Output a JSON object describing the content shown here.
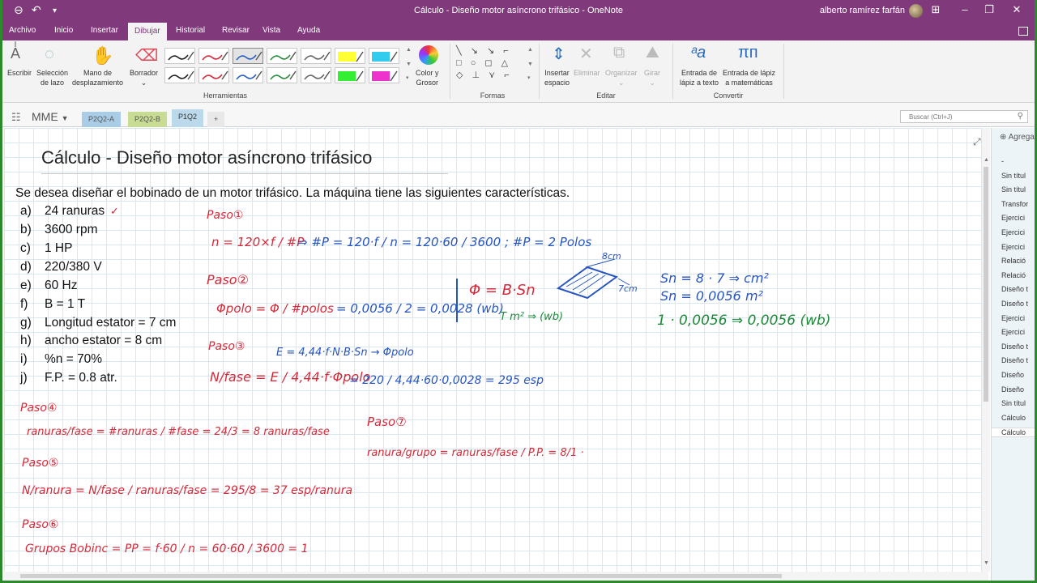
{
  "window": {
    "title": "Cálculo - Diseño motor asíncrono trifásico  -  OneNote",
    "user": "alberto ramírez farfán"
  },
  "ribbon_tabs": [
    "Archivo",
    "Inicio",
    "Insertar",
    "Dibujar",
    "Historial",
    "Revisar",
    "Vista",
    "Ayuda"
  ],
  "ribbon": {
    "escribir": "Escribir",
    "seleccion": [
      "Selección",
      "de lazo"
    ],
    "mano": [
      "Mano de",
      "desplazamiento"
    ],
    "borrador": "Borrador",
    "color": [
      "Color y",
      "Grosor"
    ],
    "insertar": [
      "Insertar",
      "espacio"
    ],
    "eliminar": "Eliminar",
    "organizar": "Organizar",
    "girar": "Girar",
    "lapiz_texto": [
      "Entrada de",
      "lápiz a texto"
    ],
    "lapiz_mat": [
      "Entrada de lápiz",
      "a matemáticas"
    ],
    "groups": [
      "Herramientas",
      "Formas",
      "Editar",
      "Convertir"
    ],
    "pen_colors": [
      "#222222",
      "#d42a3a",
      "#2a5fc0",
      "#2a8a3a",
      "#666666",
      "#ffff33",
      "#33ccee",
      "#222222",
      "#d42a3a",
      "#2a5fc0",
      "#2a8a3a",
      "#666666",
      "#33ee33",
      "#ee33cc"
    ]
  },
  "notebook": {
    "name": "MME",
    "sections": [
      "P2Q2-A",
      "P2Q2-B",
      "P1Q2"
    ],
    "add_section": "+",
    "search_placeholder": "Buscar (Ctrl+J)"
  },
  "page": {
    "title": "Cálculo - Diseño motor asíncrono trifásico",
    "intro": "Se desea diseñar el bobinado de un motor trifásico. La máquina tiene las siguientes características.",
    "items": [
      {
        "letter": "a)",
        "text": "24 ranuras"
      },
      {
        "letter": "b)",
        "text": "3600 rpm"
      },
      {
        "letter": "c)",
        "text": "1 HP"
      },
      {
        "letter": "d)",
        "text": "220/380 V"
      },
      {
        "letter": "e)",
        "text": "60 Hz"
      },
      {
        "letter": "f)",
        "text": "B = 1 T"
      },
      {
        "letter": "g)",
        "text": "Longitud estator = 7 cm"
      },
      {
        "letter": "h)",
        "text": "ancho estator = 8 cm"
      },
      {
        "letter": "i)",
        "text": "%n = 70%"
      },
      {
        "letter": "j)",
        "text": "F.P. = 0.8 atr."
      }
    ],
    "checkmark": "✓"
  },
  "ink": {
    "paso1": "Paso①",
    "eq1a": "n = 120×f / #P",
    "eq1b": "⇒ #P = 120·f / n = 120·60 / 3600 ; #P = 2 Polos",
    "paso2": "Paso②",
    "eq2a": "Φpolo = Φ / #polos",
    "eq2b": "= 0,0056 / 2 = 0,0028 (wb)",
    "eq2c": "Φ = B·Sn",
    "eq2d": "T    m² ⇒ (wb)",
    "dim1": "8cm",
    "dim2": "7cm",
    "sn1": "Sn = 8 · 7 ⇒ cm²",
    "sn2": "Sn = 0,0056 m²",
    "sn3": "1 · 0,0056 ⇒ 0,0056 (wb)",
    "paso3": "Paso③",
    "eq3a": "E = 4,44·f·N·B·Sn → Φpolo",
    "eq3b": "N/fase = E / 4,44·f·Φpolo",
    "eq3c": "= 220 / 4,44·60·0,0028 = 295 esp",
    "paso4": "Paso④",
    "eq4": "ranuras/fase = #ranuras / #fase = 24/3 = 8 ranuras/fase",
    "paso5": "Paso⑤",
    "eq5": "N/ranura = N/fase / ranuras/fase = 295/8 = 37 esp/ranura",
    "paso6": "Paso⑥",
    "eq6": "Grupos Bobinc = PP = f·60 / n = 60·60 / 3600 = 1",
    "paso7": "Paso⑦",
    "eq7": "ranura/grupo = ranuras/fase / P.P. = 8/1 ·"
  },
  "page_list": {
    "add": "Agregar página",
    "items": [
      "-",
      "Sin títul",
      "Sin títul",
      "Transfor",
      "Ejercici",
      "Ejercici",
      "Ejercici",
      "Relació",
      "Relació",
      "Diseño t",
      "Diseño t",
      "Ejercici",
      "Ejercici",
      "Diseño t",
      "Diseño t",
      "Diseño",
      "Diseño",
      "Sin títul",
      "Cálculo",
      "Cálculo"
    ]
  }
}
